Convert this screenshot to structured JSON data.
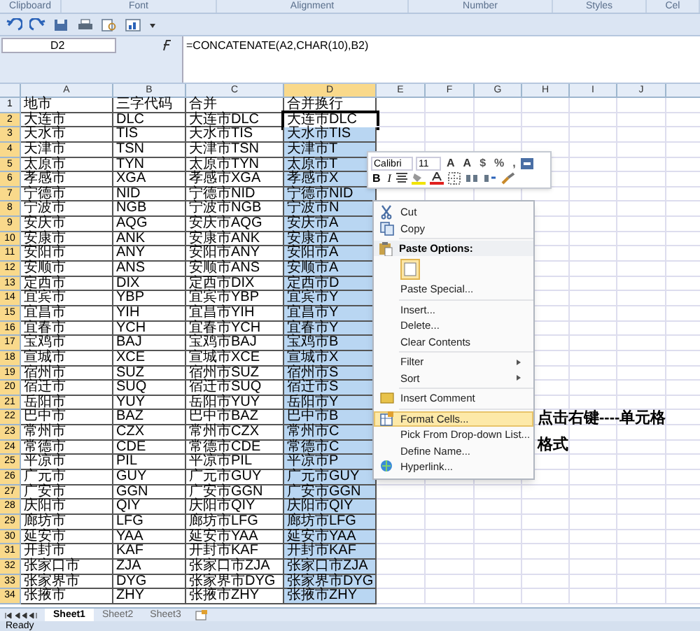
{
  "ribbon": {
    "groups": [
      "Clipboard",
      "Font",
      "Alignment",
      "Number",
      "Styles",
      "Cel"
    ]
  },
  "formula_bar": {
    "name_box": "D2",
    "formula": "=CONCATENATE(A2,CHAR(10),B2)"
  },
  "columns": [
    {
      "label": "A",
      "selected": false
    },
    {
      "label": "B",
      "selected": false
    },
    {
      "label": "C",
      "selected": false
    },
    {
      "label": "D",
      "selected": true
    },
    {
      "label": "E",
      "selected": false
    },
    {
      "label": "F",
      "selected": false
    },
    {
      "label": "G",
      "selected": false
    },
    {
      "label": "H",
      "selected": false
    },
    {
      "label": "I",
      "selected": false
    },
    {
      "label": "J",
      "selected": false
    }
  ],
  "rows": [
    {
      "number": "1",
      "cells": [
        "地市",
        "三字代码",
        "合并",
        "合并换行"
      ],
      "selected": false,
      "active": false
    },
    {
      "number": "2",
      "cells": [
        "大连市",
        "DLC",
        "大连市DLC",
        "大连市DLC"
      ],
      "selected": true,
      "active": true
    },
    {
      "number": "3",
      "cells": [
        "天水市",
        "TIS",
        "天水市TIS",
        "天水市TIS"
      ],
      "selected": true,
      "active": false
    },
    {
      "number": "4",
      "cells": [
        "天津市",
        "TSN",
        "天津市TSN",
        "天津市T"
      ],
      "selected": true,
      "active": false
    },
    {
      "number": "5",
      "cells": [
        "太原市",
        "TYN",
        "太原市TYN",
        "太原市T"
      ],
      "selected": true,
      "active": false
    },
    {
      "number": "6",
      "cells": [
        "孝感市",
        "XGA",
        "孝感市XGA",
        "孝感市X"
      ],
      "selected": true,
      "active": false
    },
    {
      "number": "7",
      "cells": [
        "宁德市",
        "NID",
        "宁德市NID",
        "宁德市NID"
      ],
      "selected": true,
      "active": false
    },
    {
      "number": "8",
      "cells": [
        "宁波市",
        "NGB",
        "宁波市NGB",
        "宁波市N"
      ],
      "selected": true,
      "active": false
    },
    {
      "number": "9",
      "cells": [
        "安庆市",
        "AQG",
        "安庆市AQG",
        "安庆市A"
      ],
      "selected": true,
      "active": false
    },
    {
      "number": "10",
      "cells": [
        "安康市",
        "ANK",
        "安康市ANK",
        "安康市A"
      ],
      "selected": true,
      "active": false
    },
    {
      "number": "11",
      "cells": [
        "安阳市",
        "ANY",
        "安阳市ANY",
        "安阳市A"
      ],
      "selected": true,
      "active": false
    },
    {
      "number": "12",
      "cells": [
        "安顺市",
        "ANS",
        "安顺市ANS",
        "安顺市A"
      ],
      "selected": true,
      "active": false
    },
    {
      "number": "13",
      "cells": [
        "定西市",
        "DIX",
        "定西市DIX",
        "定西市D"
      ],
      "selected": true,
      "active": false
    },
    {
      "number": "14",
      "cells": [
        "宜宾市",
        "YBP",
        "宜宾市YBP",
        "宜宾市Y"
      ],
      "selected": true,
      "active": false
    },
    {
      "number": "15",
      "cells": [
        "宜昌市",
        "YIH",
        "宜昌市YIH",
        "宜昌市Y"
      ],
      "selected": true,
      "active": false
    },
    {
      "number": "16",
      "cells": [
        "宜春市",
        "YCH",
        "宜春市YCH",
        "宜春市Y"
      ],
      "selected": true,
      "active": false
    },
    {
      "number": "17",
      "cells": [
        "宝鸡市",
        "BAJ",
        "宝鸡市BAJ",
        "宝鸡市B"
      ],
      "selected": true,
      "active": false
    },
    {
      "number": "18",
      "cells": [
        "宣城市",
        "XCE",
        "宣城市XCE",
        "宣城市X"
      ],
      "selected": true,
      "active": false
    },
    {
      "number": "19",
      "cells": [
        "宿州市",
        "SUZ",
        "宿州市SUZ",
        "宿州市S"
      ],
      "selected": true,
      "active": false
    },
    {
      "number": "20",
      "cells": [
        "宿迁市",
        "SUQ",
        "宿迁市SUQ",
        "宿迁市S"
      ],
      "selected": true,
      "active": false
    },
    {
      "number": "21",
      "cells": [
        "岳阳市",
        "YUY",
        "岳阳市YUY",
        "岳阳市Y"
      ],
      "selected": true,
      "active": false
    },
    {
      "number": "22",
      "cells": [
        "巴中市",
        "BAZ",
        "巴中市BAZ",
        "巴中市B"
      ],
      "selected": true,
      "active": false
    },
    {
      "number": "23",
      "cells": [
        "常州市",
        "CZX",
        "常州市CZX",
        "常州市C"
      ],
      "selected": true,
      "active": false
    },
    {
      "number": "24",
      "cells": [
        "常德市",
        "CDE",
        "常德市CDE",
        "常德市C"
      ],
      "selected": true,
      "active": false
    },
    {
      "number": "25",
      "cells": [
        "平凉市",
        "PIL",
        "平凉市PIL",
        "平凉市P"
      ],
      "selected": true,
      "active": false
    },
    {
      "number": "26",
      "cells": [
        "广元市",
        "GUY",
        "广元市GUY",
        "广元市GUY"
      ],
      "selected": true,
      "active": false
    },
    {
      "number": "27",
      "cells": [
        "广安市",
        "GGN",
        "广安市GGN",
        "广安市GGN"
      ],
      "selected": true,
      "active": false
    },
    {
      "number": "28",
      "cells": [
        "庆阳市",
        "QIY",
        "庆阳市QIY",
        "庆阳市QIY"
      ],
      "selected": true,
      "active": false
    },
    {
      "number": "29",
      "cells": [
        "廊坊市",
        "LFG",
        "廊坊市LFG",
        "廊坊市LFG"
      ],
      "selected": true,
      "active": false
    },
    {
      "number": "30",
      "cells": [
        "延安市",
        "YAA",
        "延安市YAA",
        "延安市YAA"
      ],
      "selected": true,
      "active": false
    },
    {
      "number": "31",
      "cells": [
        "开封市",
        "KAF",
        "开封市KAF",
        "开封市KAF"
      ],
      "selected": true,
      "active": false
    },
    {
      "number": "32",
      "cells": [
        "张家口市",
        "ZJA",
        "张家口市ZJA",
        "张家口市ZJA"
      ],
      "selected": true,
      "active": false
    },
    {
      "number": "33",
      "cells": [
        "张家界市",
        "DYG",
        "张家界市DYG",
        "张家界市DYG"
      ],
      "selected": true,
      "active": false
    },
    {
      "number": "34",
      "cells": [
        "张掖市",
        "ZHY",
        "张掖市ZHY",
        "张掖市ZHY"
      ],
      "selected": true,
      "active": false
    }
  ],
  "mini_toolbar": {
    "font": "Calibri",
    "size": "11",
    "buttons_row1": [
      "A",
      "A",
      "$",
      "%",
      ","
    ],
    "buttons_row2": [
      "B",
      "I"
    ]
  },
  "context_menu": [
    {
      "kind": "item",
      "label": "Cut",
      "submenu": false,
      "selected": false
    },
    {
      "kind": "item",
      "label": "Copy",
      "submenu": false,
      "selected": false
    },
    {
      "kind": "header",
      "label": "Paste Options:"
    },
    {
      "kind": "paste_icon"
    },
    {
      "kind": "item",
      "label": "Paste Special...",
      "submenu": false,
      "selected": false
    },
    {
      "kind": "item",
      "label": "Insert...",
      "submenu": false,
      "selected": false
    },
    {
      "kind": "item",
      "label": "Delete...",
      "submenu": false,
      "selected": false
    },
    {
      "kind": "item",
      "label": "Clear Contents",
      "submenu": false,
      "selected": false
    },
    {
      "kind": "item",
      "label": "Filter",
      "submenu": true,
      "selected": false
    },
    {
      "kind": "item",
      "label": "Sort",
      "submenu": true,
      "selected": false
    },
    {
      "kind": "item",
      "label": "Insert Comment",
      "submenu": false,
      "selected": false
    },
    {
      "kind": "item",
      "label": "Format Cells...",
      "submenu": false,
      "selected": true
    },
    {
      "kind": "item",
      "label": "Pick From Drop-down List...",
      "submenu": false,
      "selected": false
    },
    {
      "kind": "item",
      "label": "Define Name...",
      "submenu": false,
      "selected": false
    },
    {
      "kind": "item",
      "label": "Hyperlink...",
      "submenu": false,
      "selected": false
    }
  ],
  "annotation": [
    "点击右键----单元格",
    "格式"
  ],
  "sheet_tabs": [
    {
      "label": "Sheet1",
      "selected": true
    },
    {
      "label": "Sheet2",
      "selected": false
    },
    {
      "label": "Sheet3",
      "selected": false
    }
  ],
  "status_bar": {
    "text": "Ready"
  }
}
